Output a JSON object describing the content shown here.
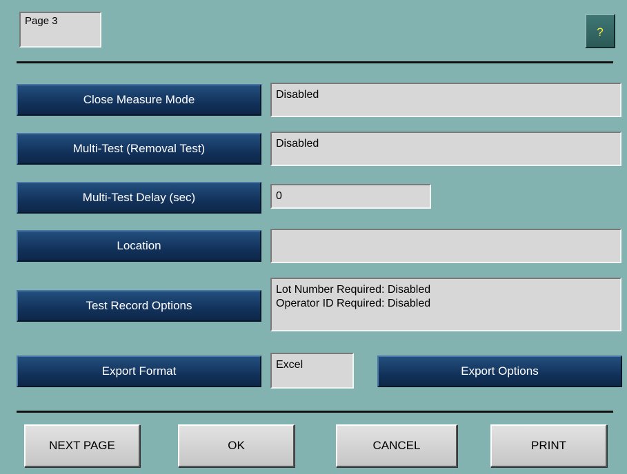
{
  "header": {
    "page_label": "Page 3",
    "help_label": "?"
  },
  "settings": {
    "close_measure_mode": {
      "label": "Close Measure Mode",
      "value": "Disabled"
    },
    "multi_test": {
      "label": "Multi-Test (Removal Test)",
      "value": "Disabled"
    },
    "multi_test_delay": {
      "label": "Multi-Test Delay (sec)",
      "value": "0"
    },
    "location": {
      "label": "Location",
      "value": ""
    },
    "test_record_options": {
      "label": "Test Record Options",
      "lines": [
        "Lot Number Required: Disabled",
        "Operator ID Required: Disabled"
      ]
    },
    "export_format": {
      "label": "Export Format",
      "value": "Excel"
    },
    "export_options": {
      "label": "Export Options"
    }
  },
  "footer": {
    "next_page": "NEXT PAGE",
    "ok": "OK",
    "cancel": "CANCEL",
    "print": "PRINT"
  },
  "colors": {
    "background": "#83b3b0",
    "nav_button": "#12325b",
    "field": "#d7d7d7",
    "help_text": "#ffee33"
  }
}
